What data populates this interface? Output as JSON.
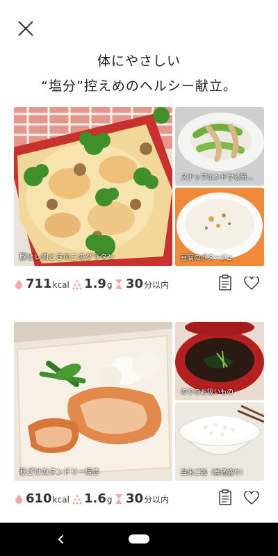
{
  "headline": {
    "line1": "体にやさしい",
    "line2": "“塩分”控えめのヘルシー献立。"
  },
  "menus": [
    {
      "main": {
        "caption": "豚ヒレ肉ときのこのグラタン"
      },
      "side1": {
        "caption": "スナップエンドウと新..."
      },
      "side2": {
        "caption": "豆腐のポタージュ"
      },
      "stats": {
        "kcal": "711",
        "kcal_unit": "kcal",
        "salt": "1.9",
        "salt_unit": "g",
        "time": "30",
        "time_unit": "分以内"
      }
    },
    {
      "main": {
        "caption": "秋ざけのタンドリー焼き"
      },
      "side1": {
        "caption": "のりのお吸いもの"
      },
      "side2": {
        "caption": "白米ご飯（普通盛り）"
      },
      "stats": {
        "kcal": "610",
        "kcal_unit": "kcal",
        "salt": "1.6",
        "salt_unit": "g",
        "time": "30",
        "time_unit": "分以内"
      }
    }
  ],
  "icons": {
    "close": "close-icon",
    "calorie": "flame-icon",
    "salt": "salt-icon",
    "time": "hourglass-icon",
    "menu": "clipboard-icon",
    "favorite": "heart-icon",
    "back": "chevron-left-icon"
  },
  "colors": {
    "accent_pink": "#f3a9a6",
    "text": "#222222",
    "navbar": "#000000"
  }
}
